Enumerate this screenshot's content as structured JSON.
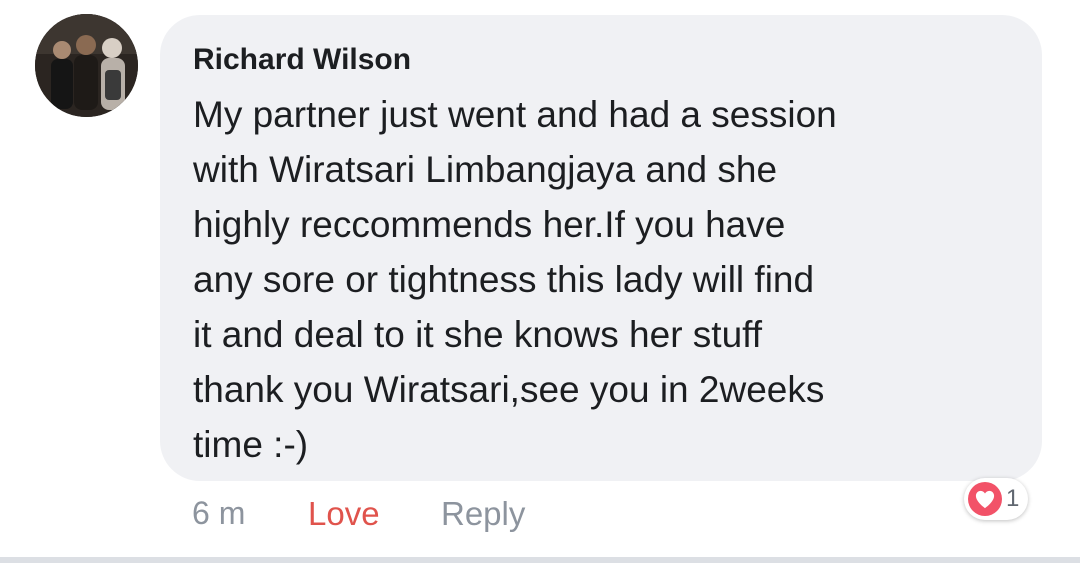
{
  "comment": {
    "author": "Richard Wilson",
    "text": "My partner just went and had a session\nwith Wiratsari Limbangjaya and she\nhighly reccommends her.If you have\nany sore or tightness this lady will find\nit and deal to it she knows her stuff\nthank you Wiratsari,see you in 2weeks\ntime :-)",
    "time": "6 m",
    "love_label": "Love",
    "reply_label": "Reply",
    "reaction": {
      "icon": "heart-icon",
      "count": "1"
    }
  },
  "colors": {
    "bubble": "#f0f1f4",
    "love": "#e0534c",
    "muted": "#8d949e",
    "reaction_heart": "#f25268"
  }
}
